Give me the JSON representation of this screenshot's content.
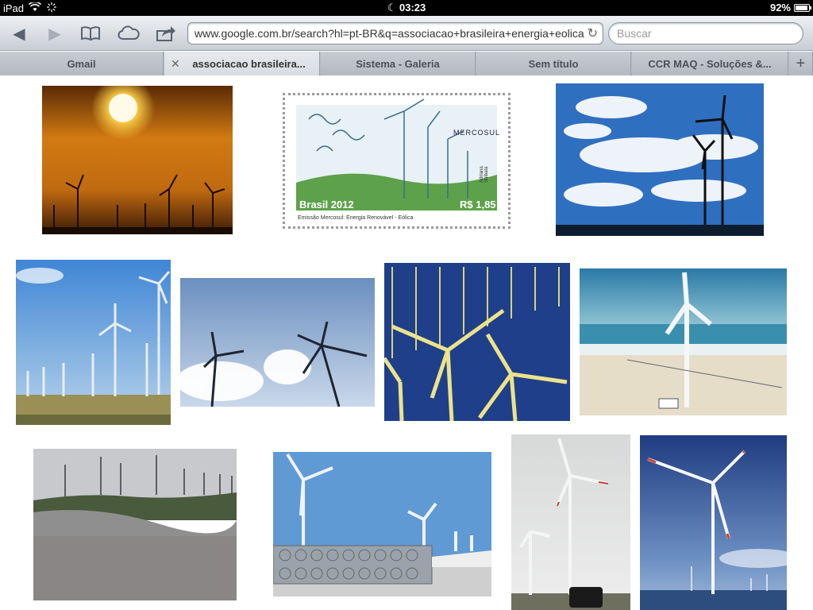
{
  "status": {
    "device": "iPad",
    "time": "03:23",
    "battery": "92%",
    "battery_level": 0.92
  },
  "toolbar": {
    "url": "www.google.com.br/search?hl=pt-BR&q=associacao+brasileira+energia+eolica",
    "search_placeholder": "Buscar"
  },
  "tabs": [
    {
      "label": "Gmail"
    },
    {
      "label": "associacao brasileira..."
    },
    {
      "label": "Sistema - Galeria"
    },
    {
      "label": "Sem título"
    },
    {
      "label": "CCR MAQ - Soluções &..."
    }
  ],
  "stamp": {
    "brand": "MERCOSUL",
    "country_year": "Brasil 2012",
    "value": "R$ 1,85",
    "caption": "Emissão Mercosul: Energia Renovável - Eólica",
    "artist": "Adriana Shibata"
  }
}
